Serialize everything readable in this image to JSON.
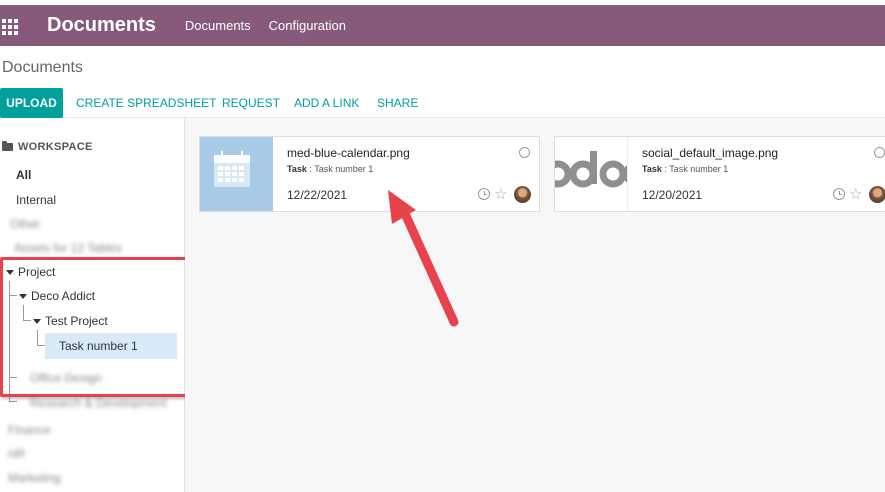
{
  "navbar": {
    "brand": "Documents",
    "menu": [
      "Documents",
      "Configuration"
    ]
  },
  "control": {
    "breadcrumb": "Documents",
    "buttons": {
      "upload": "UPLOAD",
      "create_spreadsheet": "CREATE SPREADSHEET",
      "request": "REQUEST",
      "add_link": "ADD A LINK",
      "share": "SHARE"
    }
  },
  "sidebar": {
    "section_title": "WORKSPACE",
    "items": {
      "all": "All",
      "internal": "Internal",
      "blur1": "Other",
      "blur2": "Assets for 12 Tables",
      "project": "Project",
      "deco_addict": "Deco Addict",
      "test_project": "Test Project",
      "task_number_1": "Task number 1",
      "blur3": "Office Design",
      "blur4": "Research & Development",
      "blur5": "Finance",
      "blur6": "HR",
      "blur7": "Marketing"
    }
  },
  "cards": [
    {
      "filename": "med-blue-calendar.png",
      "task_label": "Task",
      "task_value": "Task number 1",
      "date": "12/22/2021",
      "thumb_color": "#a9cbe8"
    },
    {
      "filename": "social_default_image.png",
      "task_label": "Task",
      "task_value": "Task number 1",
      "date": "12/20/2021",
      "thumb_text": "odoo"
    }
  ],
  "colors": {
    "navbar": "#875a7b",
    "accent": "#00a09d",
    "highlight": "#e8424c",
    "selected_bg": "#d6ebf7"
  }
}
